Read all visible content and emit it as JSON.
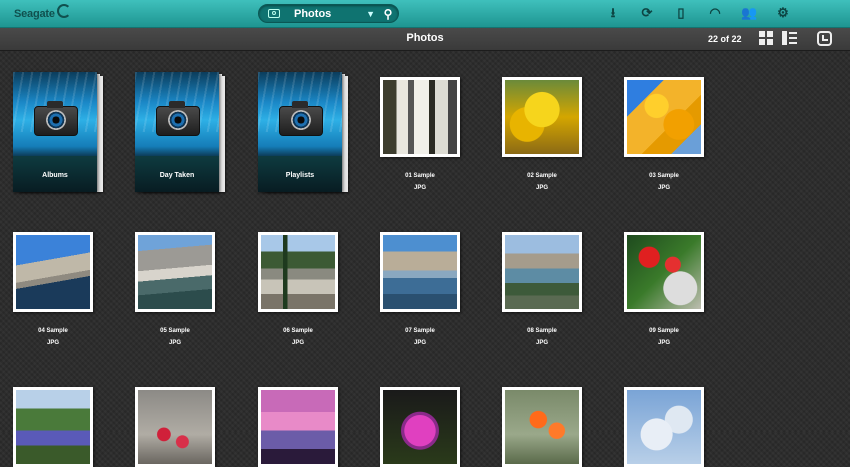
{
  "header": {
    "logo_text": "Seagate",
    "selector_label": "Photos",
    "icons": [
      "upload-icon",
      "sync-icon",
      "battery-icon",
      "wifi-icon",
      "users-icon",
      "settings-icon"
    ]
  },
  "subheader": {
    "title": "Photos",
    "count": "22 of 22"
  },
  "albums": [
    {
      "label": "Albums"
    },
    {
      "label": "Day Taken"
    },
    {
      "label": "Playlists"
    }
  ],
  "photos": [
    {
      "name": "01 Sample",
      "type": "JPG"
    },
    {
      "name": "02 Sample",
      "type": "JPG"
    },
    {
      "name": "03 Sample",
      "type": "JPG"
    },
    {
      "name": "04 Sample",
      "type": "JPG"
    },
    {
      "name": "05 Sample",
      "type": "JPG"
    },
    {
      "name": "06 Sample",
      "type": "JPG"
    },
    {
      "name": "07 Sample",
      "type": "JPG"
    },
    {
      "name": "08 Sample",
      "type": "JPG"
    },
    {
      "name": "09 Sample",
      "type": "JPG"
    }
  ],
  "theme": {
    "header_teal": "#2bb0ac",
    "background": "#2a2a2a"
  }
}
